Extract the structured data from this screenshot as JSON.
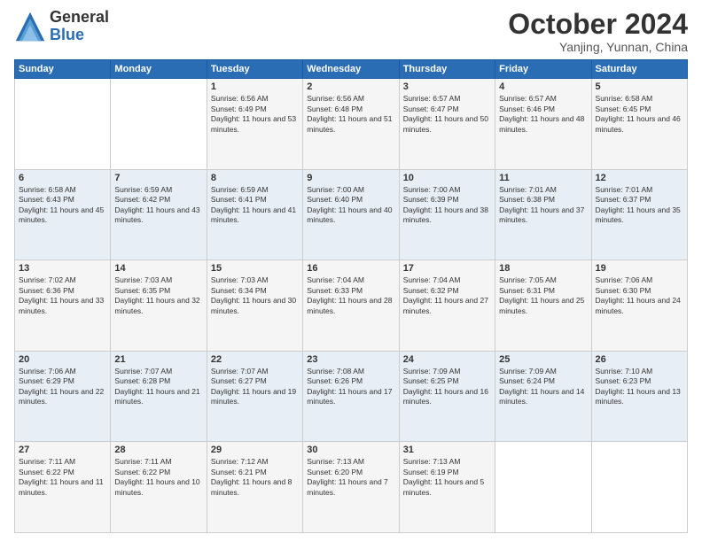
{
  "logo": {
    "general": "General",
    "blue": "Blue"
  },
  "title": "October 2024",
  "location": "Yanjing, Yunnan, China",
  "days_of_week": [
    "Sunday",
    "Monday",
    "Tuesday",
    "Wednesday",
    "Thursday",
    "Friday",
    "Saturday"
  ],
  "weeks": [
    [
      null,
      null,
      {
        "day": 1,
        "sunrise": "6:56 AM",
        "sunset": "6:49 PM",
        "daylight": "11 hours and 53 minutes."
      },
      {
        "day": 2,
        "sunrise": "6:56 AM",
        "sunset": "6:48 PM",
        "daylight": "11 hours and 51 minutes."
      },
      {
        "day": 3,
        "sunrise": "6:57 AM",
        "sunset": "6:47 PM",
        "daylight": "11 hours and 50 minutes."
      },
      {
        "day": 4,
        "sunrise": "6:57 AM",
        "sunset": "6:46 PM",
        "daylight": "11 hours and 48 minutes."
      },
      {
        "day": 5,
        "sunrise": "6:58 AM",
        "sunset": "6:45 PM",
        "daylight": "11 hours and 46 minutes."
      }
    ],
    [
      {
        "day": 6,
        "sunrise": "6:58 AM",
        "sunset": "6:43 PM",
        "daylight": "11 hours and 45 minutes."
      },
      {
        "day": 7,
        "sunrise": "6:59 AM",
        "sunset": "6:42 PM",
        "daylight": "11 hours and 43 minutes."
      },
      {
        "day": 8,
        "sunrise": "6:59 AM",
        "sunset": "6:41 PM",
        "daylight": "11 hours and 41 minutes."
      },
      {
        "day": 9,
        "sunrise": "7:00 AM",
        "sunset": "6:40 PM",
        "daylight": "11 hours and 40 minutes."
      },
      {
        "day": 10,
        "sunrise": "7:00 AM",
        "sunset": "6:39 PM",
        "daylight": "11 hours and 38 minutes."
      },
      {
        "day": 11,
        "sunrise": "7:01 AM",
        "sunset": "6:38 PM",
        "daylight": "11 hours and 37 minutes."
      },
      {
        "day": 12,
        "sunrise": "7:01 AM",
        "sunset": "6:37 PM",
        "daylight": "11 hours and 35 minutes."
      }
    ],
    [
      {
        "day": 13,
        "sunrise": "7:02 AM",
        "sunset": "6:36 PM",
        "daylight": "11 hours and 33 minutes."
      },
      {
        "day": 14,
        "sunrise": "7:03 AM",
        "sunset": "6:35 PM",
        "daylight": "11 hours and 32 minutes."
      },
      {
        "day": 15,
        "sunrise": "7:03 AM",
        "sunset": "6:34 PM",
        "daylight": "11 hours and 30 minutes."
      },
      {
        "day": 16,
        "sunrise": "7:04 AM",
        "sunset": "6:33 PM",
        "daylight": "11 hours and 28 minutes."
      },
      {
        "day": 17,
        "sunrise": "7:04 AM",
        "sunset": "6:32 PM",
        "daylight": "11 hours and 27 minutes."
      },
      {
        "day": 18,
        "sunrise": "7:05 AM",
        "sunset": "6:31 PM",
        "daylight": "11 hours and 25 minutes."
      },
      {
        "day": 19,
        "sunrise": "7:06 AM",
        "sunset": "6:30 PM",
        "daylight": "11 hours and 24 minutes."
      }
    ],
    [
      {
        "day": 20,
        "sunrise": "7:06 AM",
        "sunset": "6:29 PM",
        "daylight": "11 hours and 22 minutes."
      },
      {
        "day": 21,
        "sunrise": "7:07 AM",
        "sunset": "6:28 PM",
        "daylight": "11 hours and 21 minutes."
      },
      {
        "day": 22,
        "sunrise": "7:07 AM",
        "sunset": "6:27 PM",
        "daylight": "11 hours and 19 minutes."
      },
      {
        "day": 23,
        "sunrise": "7:08 AM",
        "sunset": "6:26 PM",
        "daylight": "11 hours and 17 minutes."
      },
      {
        "day": 24,
        "sunrise": "7:09 AM",
        "sunset": "6:25 PM",
        "daylight": "11 hours and 16 minutes."
      },
      {
        "day": 25,
        "sunrise": "7:09 AM",
        "sunset": "6:24 PM",
        "daylight": "11 hours and 14 minutes."
      },
      {
        "day": 26,
        "sunrise": "7:10 AM",
        "sunset": "6:23 PM",
        "daylight": "11 hours and 13 minutes."
      }
    ],
    [
      {
        "day": 27,
        "sunrise": "7:11 AM",
        "sunset": "6:22 PM",
        "daylight": "11 hours and 11 minutes."
      },
      {
        "day": 28,
        "sunrise": "7:11 AM",
        "sunset": "6:22 PM",
        "daylight": "11 hours and 10 minutes."
      },
      {
        "day": 29,
        "sunrise": "7:12 AM",
        "sunset": "6:21 PM",
        "daylight": "11 hours and 8 minutes."
      },
      {
        "day": 30,
        "sunrise": "7:13 AM",
        "sunset": "6:20 PM",
        "daylight": "11 hours and 7 minutes."
      },
      {
        "day": 31,
        "sunrise": "7:13 AM",
        "sunset": "6:19 PM",
        "daylight": "11 hours and 5 minutes."
      },
      null,
      null
    ]
  ]
}
